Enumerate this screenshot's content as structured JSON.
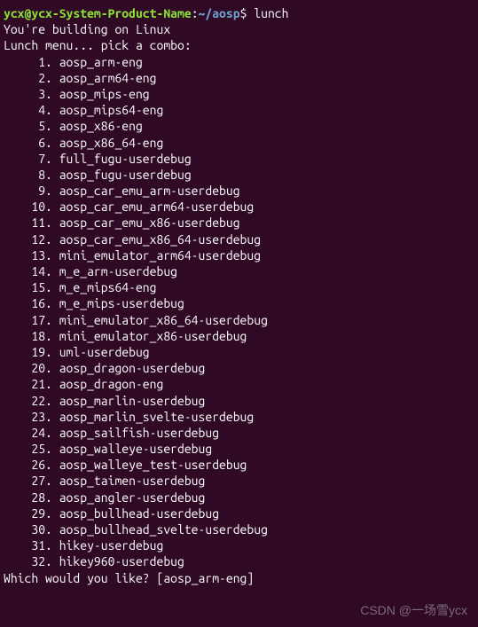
{
  "prompt": {
    "user_host": "ycx@ycx-System-Product-Name",
    "separator1": ":",
    "path": "~/aosp",
    "dollar": "$ ",
    "command": "lunch"
  },
  "output": {
    "building_line": "You're building on Linux",
    "blank": "",
    "menu_header": "Lunch menu... pick a combo:"
  },
  "menu_items": [
    "     1. aosp_arm-eng",
    "     2. aosp_arm64-eng",
    "     3. aosp_mips-eng",
    "     4. aosp_mips64-eng",
    "     5. aosp_x86-eng",
    "     6. aosp_x86_64-eng",
    "     7. full_fugu-userdebug",
    "     8. aosp_fugu-userdebug",
    "     9. aosp_car_emu_arm-userdebug",
    "    10. aosp_car_emu_arm64-userdebug",
    "    11. aosp_car_emu_x86-userdebug",
    "    12. aosp_car_emu_x86_64-userdebug",
    "    13. mini_emulator_arm64-userdebug",
    "    14. m_e_arm-userdebug",
    "    15. m_e_mips64-eng",
    "    16. m_e_mips-userdebug",
    "    17. mini_emulator_x86_64-userdebug",
    "    18. mini_emulator_x86-userdebug",
    "    19. uml-userdebug",
    "    20. aosp_dragon-userdebug",
    "    21. aosp_dragon-eng",
    "    22. aosp_marlin-userdebug",
    "    23. aosp_marlin_svelte-userdebug",
    "    24. aosp_sailfish-userdebug",
    "    25. aosp_walleye-userdebug",
    "    26. aosp_walleye_test-userdebug",
    "    27. aosp_taimen-userdebug",
    "    28. aosp_angler-userdebug",
    "    29. aosp_bullhead-userdebug",
    "    30. aosp_bullhead_svelte-userdebug",
    "    31. hikey-userdebug",
    "    32. hikey960-userdebug"
  ],
  "input_prompt": "Which would you like? [aosp_arm-eng] ",
  "watermark": "CSDN @一场雪ycx"
}
